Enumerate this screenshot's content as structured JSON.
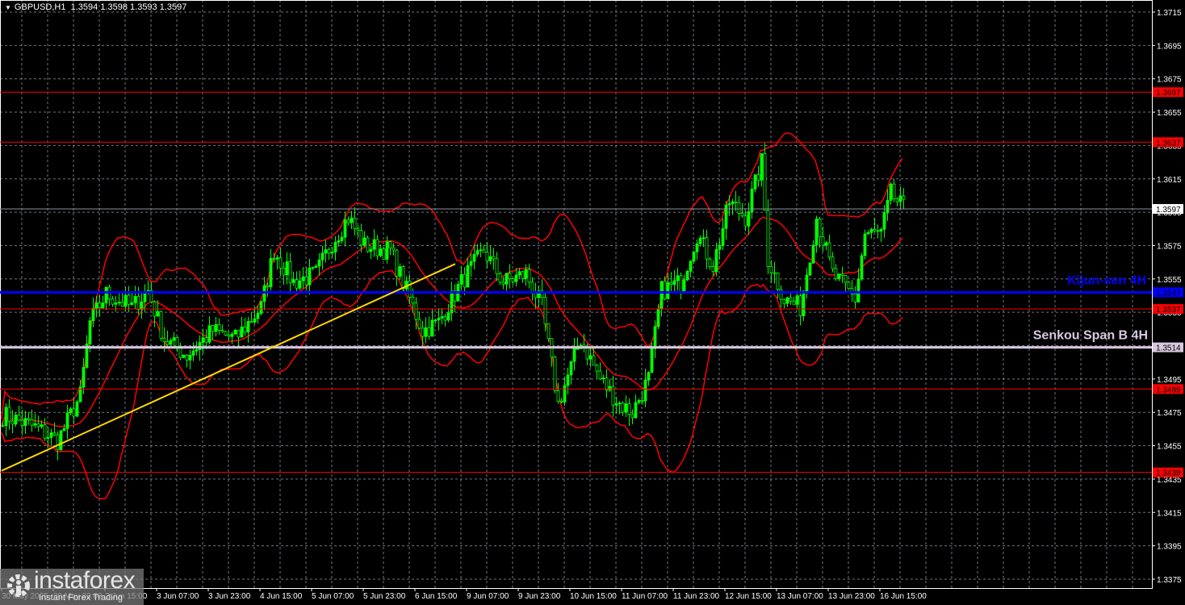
{
  "header": {
    "symbol": "GBPUSD,H1",
    "ohlc": "1.3594 1.3598 1.3593 1.3597"
  },
  "logo": {
    "name": "instaforex",
    "tagline": "Instant Forex Trading"
  },
  "colors": {
    "bull": "#00ff00",
    "level": "#ff0000",
    "kijun": "#0000ff",
    "senkou": "#d8c8e0",
    "trend": "#ffd700",
    "grid": "#8a94a0"
  },
  "chart_data": {
    "type": "candlestick",
    "title": "GBPUSD,H1",
    "ylim": [
      1.3365,
      1.3725
    ],
    "y_ticks": [
      "1.3715",
      "1.3695",
      "1.3675",
      "1.3655",
      "1.3635",
      "1.3615",
      "1.3595",
      "1.3575",
      "1.3555",
      "1.3535",
      "1.3515",
      "1.3495",
      "1.3475",
      "1.3455",
      "1.3435",
      "1.3415",
      "1.3395",
      "1.3375"
    ],
    "x_ticks": [
      {
        "hour": 0,
        "label": "30 May 2025"
      },
      {
        "hour": 16,
        "label": "30 May 23:00"
      },
      {
        "hour": 32,
        "label": "2 Jun 15:00"
      },
      {
        "hour": 48,
        "label": "3 Jun 07:00"
      },
      {
        "hour": 64,
        "label": "3 Jun 23:00"
      },
      {
        "hour": 80,
        "label": "4 Jun 15:00"
      },
      {
        "hour": 96,
        "label": "5 Jun 07:00"
      },
      {
        "hour": 112,
        "label": "5 Jun 23:00"
      },
      {
        "hour": 128,
        "label": "6 Jun 15:00"
      },
      {
        "hour": 144,
        "label": "9 Jun 07:00"
      },
      {
        "hour": 160,
        "label": "9 Jun 23:00"
      },
      {
        "hour": 176,
        "label": "10 Jun 15:00"
      },
      {
        "hour": 192,
        "label": "11 Jun 07:00"
      },
      {
        "hour": 208,
        "label": "11 Jun 23:00"
      },
      {
        "hour": 224,
        "label": "12 Jun 15:00"
      },
      {
        "hour": 240,
        "label": "13 Jun 07:00"
      },
      {
        "hour": 256,
        "label": "13 Jun 23:00"
      },
      {
        "hour": 272,
        "label": "16 Jun 15:00"
      }
    ],
    "close_waypoints": [
      [
        1,
        1.3473
      ],
      [
        10,
        1.3466
      ],
      [
        17,
        1.3458
      ],
      [
        24,
        1.3485
      ],
      [
        27,
        1.3529
      ],
      [
        32,
        1.3546
      ],
      [
        40,
        1.3538
      ],
      [
        45,
        1.3548
      ],
      [
        50,
        1.3519
      ],
      [
        57,
        1.3509
      ],
      [
        65,
        1.3524
      ],
      [
        72,
        1.3519
      ],
      [
        80,
        1.3538
      ],
      [
        84,
        1.3572
      ],
      [
        90,
        1.3553
      ],
      [
        97,
        1.3558
      ],
      [
        102,
        1.3577
      ],
      [
        107,
        1.3592
      ],
      [
        112,
        1.3575
      ],
      [
        120,
        1.3572
      ],
      [
        125,
        1.3548
      ],
      [
        130,
        1.3524
      ],
      [
        135,
        1.3529
      ],
      [
        142,
        1.3553
      ],
      [
        149,
        1.3572
      ],
      [
        155,
        1.3553
      ],
      [
        162,
        1.3558
      ],
      [
        167,
        1.3538
      ],
      [
        172,
        1.348
      ],
      [
        179,
        1.3519
      ],
      [
        185,
        1.3495
      ],
      [
        191,
        1.348
      ],
      [
        195,
        1.3475
      ],
      [
        200,
        1.3495
      ],
      [
        204,
        1.3548
      ],
      [
        210,
        1.3553
      ],
      [
        215,
        1.3582
      ],
      [
        220,
        1.3563
      ],
      [
        225,
        1.3601
      ],
      [
        230,
        1.3592
      ],
      [
        235,
        1.3625
      ],
      [
        237,
        1.3567
      ],
      [
        242,
        1.3543
      ],
      [
        247,
        1.3538
      ],
      [
        252,
        1.3592
      ],
      [
        257,
        1.3558
      ],
      [
        264,
        1.3543
      ],
      [
        267,
        1.3582
      ],
      [
        272,
        1.3582
      ],
      [
        275,
        1.3606
      ],
      [
        279,
        1.3597
      ]
    ],
    "levels": [
      {
        "price": 1.3667,
        "label": "1.3667",
        "kind": "resistance"
      },
      {
        "price": 1.3637,
        "label": "1.3637",
        "kind": "resistance"
      },
      {
        "price": 1.3537,
        "label": "1.3537",
        "kind": "support"
      },
      {
        "price": 1.3489,
        "label": "1.3489",
        "kind": "support"
      },
      {
        "price": 1.3439,
        "label": "1.3439",
        "kind": "support"
      }
    ],
    "kijun": {
      "price": 1.3547,
      "label": "1.3547",
      "name": "Kijun-sen 4H"
    },
    "senkou": {
      "price": 1.3514,
      "label": "1.3514",
      "name": "Senkou Span B 4H"
    },
    "current": {
      "price": 1.3597,
      "label": "1.3597"
    },
    "trendline": {
      "from": [
        0,
        1.344
      ],
      "to": [
        140.5,
        1.3564
      ]
    }
  }
}
